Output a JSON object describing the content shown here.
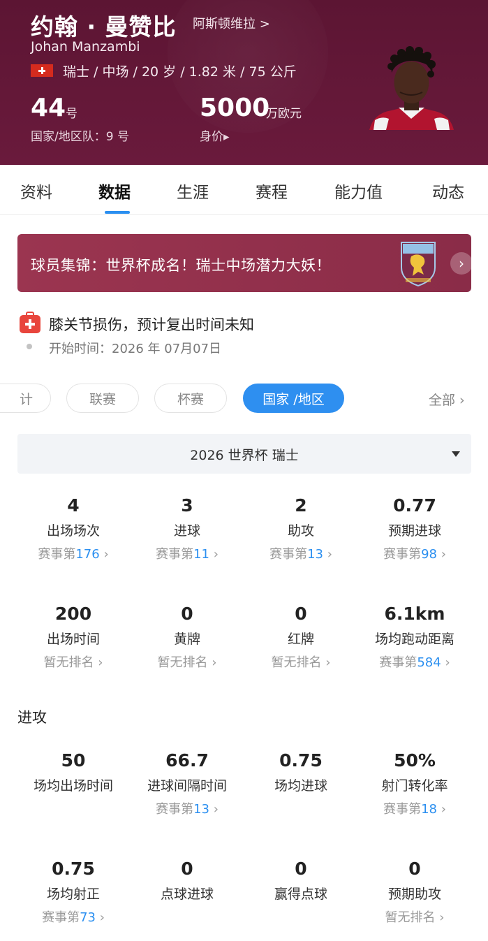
{
  "player": {
    "name_cn": "约翰 · 曼赞比",
    "club_link": "阿斯顿维拉 >",
    "name_en": "Johan Manzambi",
    "info_line": "瑞士 / 中场 / 20 岁 / 1.82 米 / 75 公斤",
    "number": "44",
    "number_unit": "号",
    "national_number": "国家/地区队：9 号",
    "market_value": "5000",
    "market_value_unit": "万欧元",
    "market_value_label": "身价▸",
    "flag_colors": {
      "bg": "#d52b1e",
      "cross": "#ffffff"
    }
  },
  "tabs": [
    {
      "label": "资料"
    },
    {
      "label": "数据",
      "active": true
    },
    {
      "label": "生涯"
    },
    {
      "label": "赛程"
    },
    {
      "label": "能力值"
    },
    {
      "label": "动态"
    }
  ],
  "banner": {
    "text": "球员集锦：世界杯成名！瑞士中场潜力大妖！",
    "arrow": "›"
  },
  "injury": {
    "text": "膝关节损伤，预计复出时间未知",
    "start": "开始时间：2026 年 07月07日"
  },
  "filters": {
    "pills": [
      {
        "label": "计"
      },
      {
        "label": "联赛"
      },
      {
        "label": "杯赛"
      },
      {
        "label": "国家 /地区",
        "active": true
      }
    ],
    "all": "全部 ›"
  },
  "competition_selector": {
    "value": "2026 世界杯 瑞士"
  },
  "stats_overview": [
    {
      "value": "4",
      "label": "出场场次",
      "rank_prefix": "赛事第",
      "rank": "176",
      "arrow": " ›"
    },
    {
      "value": "3",
      "label": "进球",
      "rank_prefix": "赛事第",
      "rank": "11",
      "arrow": " ›"
    },
    {
      "value": "2",
      "label": "助攻",
      "rank_prefix": "赛事第",
      "rank": "13",
      "arrow": " ›"
    },
    {
      "value": "0.77",
      "label": "预期进球",
      "rank_prefix": "赛事第",
      "rank": "98",
      "arrow": " ›"
    },
    {
      "value": "200",
      "label": "出场时间",
      "rank_prefix": "暂无排名",
      "rank": "",
      "arrow": " ›"
    },
    {
      "value": "0",
      "label": "黄牌",
      "rank_prefix": "暂无排名",
      "rank": "",
      "arrow": " ›"
    },
    {
      "value": "0",
      "label": "红牌",
      "rank_prefix": "暂无排名",
      "rank": "",
      "arrow": " ›"
    },
    {
      "value": "6.1km",
      "label": "场均跑动距离",
      "rank_prefix": "赛事第",
      "rank": "584",
      "arrow": " ›"
    }
  ],
  "attack": {
    "title": "进攻",
    "stats": [
      {
        "value": "50",
        "label": "场均出场时间",
        "rank_prefix": "",
        "rank": "",
        "arrow": ""
      },
      {
        "value": "66.7",
        "label": "进球间隔时间",
        "rank_prefix": "赛事第",
        "rank": "13",
        "arrow": " ›"
      },
      {
        "value": "0.75",
        "label": "场均进球",
        "rank_prefix": "",
        "rank": "",
        "arrow": ""
      },
      {
        "value": "50%",
        "label": "射门转化率",
        "rank_prefix": "赛事第",
        "rank": "18",
        "arrow": " ›"
      },
      {
        "value": "0.75",
        "label": "场均射正",
        "rank_prefix": "赛事第",
        "rank": "73",
        "arrow": " ›"
      },
      {
        "value": "0",
        "label": "点球进球",
        "rank_prefix": "",
        "rank": "",
        "arrow": ""
      },
      {
        "value": "0",
        "label": "赢得点球",
        "rank_prefix": "",
        "rank": "",
        "arrow": ""
      },
      {
        "value": "0",
        "label": "预期助攻",
        "rank_prefix": "暂无排名",
        "rank": "",
        "arrow": " ›"
      }
    ]
  },
  "colors": {
    "header_bg": "#5c1533",
    "accent_blue": "#2b8ff0",
    "banner_bg": "#9b3550",
    "injury_red": "#e8453c"
  }
}
